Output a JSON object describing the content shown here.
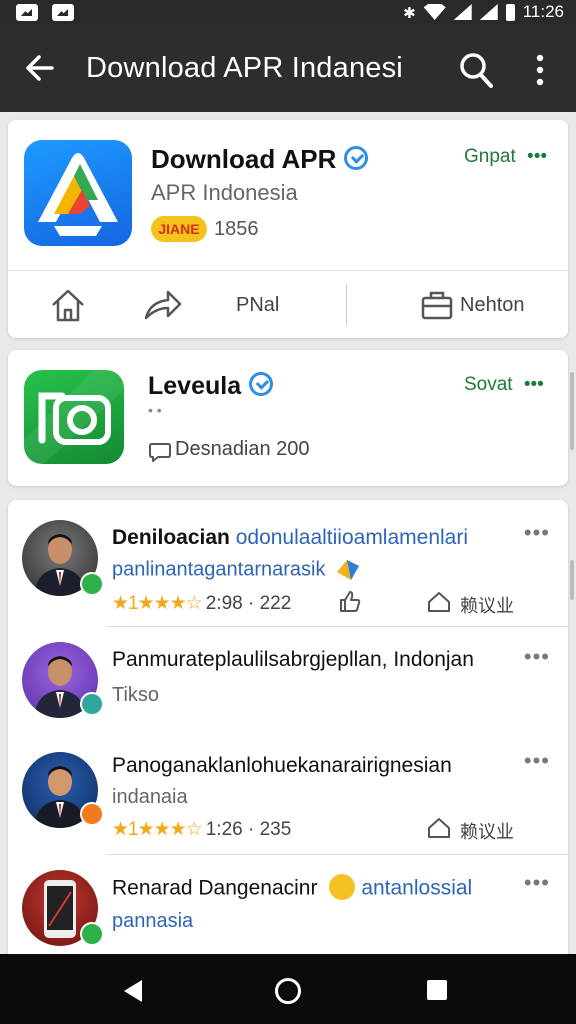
{
  "status_bar": {
    "time": "11:26"
  },
  "app_bar": {
    "title": "Download APR Indanesi"
  },
  "card1": {
    "name": "Download APR",
    "developer": "APR Indonesia",
    "action": "Gnpat",
    "more": "•••",
    "badge": "JIANE",
    "count": "1856",
    "actions": {
      "share_label": "PNal",
      "right_label": "Nehton"
    }
  },
  "card2": {
    "name": "Leveula",
    "action": "Sovat",
    "more": "•••",
    "dots": "•        •",
    "comments": "Desnadian 200"
  },
  "feed": {
    "items": [
      {
        "title_bold": "Deniloacian",
        "title_rest": " odonulaaltiioamlamenlari",
        "line2": "panlinantagantarnarasik",
        "stars": "★1★★★☆",
        "meta": "2:98 · 222",
        "like_label": "赖议业",
        "more": "•••"
      },
      {
        "title_bold": "Panmurateplaulilsabrgjepllan, Indonjan",
        "line2": "Tikso",
        "more": "•••"
      },
      {
        "title_bold": "Panoganaklanlohuekanarairignesian",
        "line2": "indanaia",
        "stars": "★1★★★☆",
        "meta": "1:26 · 235",
        "like_label": "赖议业",
        "more": "•••"
      },
      {
        "title_bold": "Renarad Dangenacinr",
        "title_blue": "antanlossial",
        "line2": "pannasia",
        "more": "•••"
      }
    ]
  },
  "colors": {
    "accent_green": "#1e7a3a",
    "verified_blue": "#2b8fe6",
    "link_blue": "#2e64b8",
    "star": "#f2a81a"
  }
}
